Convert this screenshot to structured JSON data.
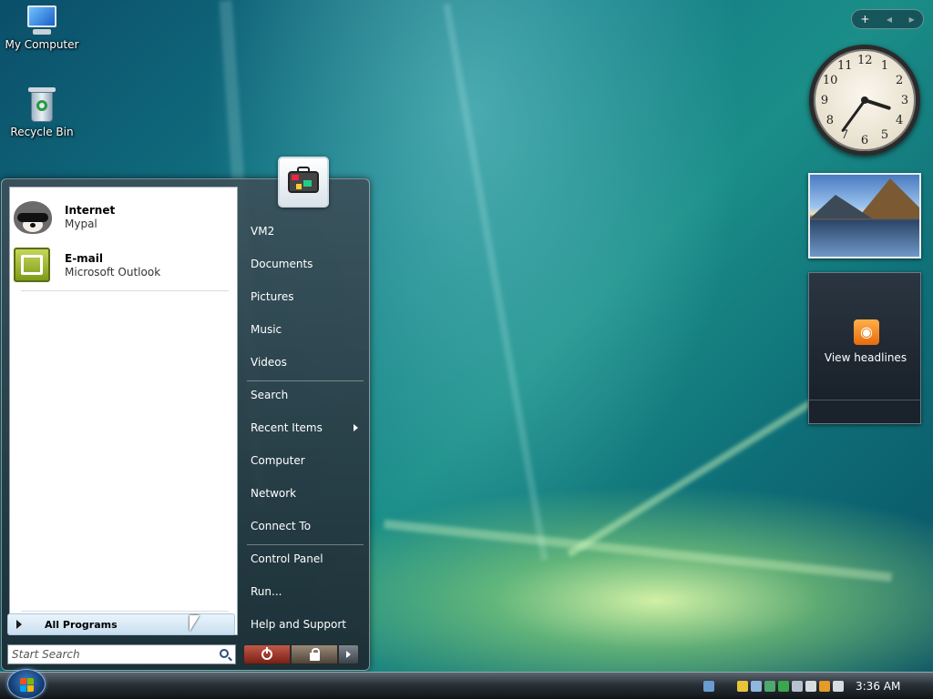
{
  "desktop": {
    "icons": [
      {
        "label": "My Computer"
      },
      {
        "label": "Recycle Bin"
      }
    ]
  },
  "sidebar": {
    "add_glyph": "+",
    "prev_glyph": "◂",
    "next_glyph": "▸",
    "clock": {
      "numbers": [
        "12",
        "1",
        "2",
        "3",
        "4",
        "5",
        "6",
        "7",
        "8",
        "9",
        "10",
        "11"
      ],
      "time": "3:36"
    },
    "feed": {
      "label": "View headlines"
    }
  },
  "start_menu": {
    "pinned": [
      {
        "title": "Internet",
        "subtitle": "Mypal",
        "icon": "raccoon-icon"
      },
      {
        "title": "E-mail",
        "subtitle": "Microsoft Outlook",
        "icon": "outlook-icon"
      }
    ],
    "all_programs": "All Programs",
    "search_placeholder": "Start Search",
    "right_items": [
      "VM2",
      "Documents",
      "Pictures",
      "Music",
      "Videos",
      "Search",
      "Recent Items",
      "Computer",
      "Network",
      "Connect To",
      "Control Panel",
      "Run...",
      "Help and Support"
    ]
  },
  "taskbar": {
    "time": "3:36 AM"
  },
  "colors": {
    "accent": "#1b8e88",
    "taskbar": "#2a3138",
    "start_menu": "#3c505a"
  }
}
